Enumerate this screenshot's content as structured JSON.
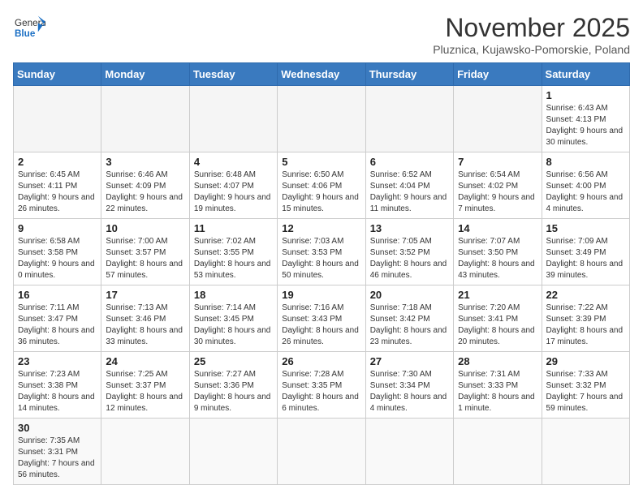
{
  "header": {
    "logo_general": "General",
    "logo_blue": "Blue",
    "month_title": "November 2025",
    "subtitle": "Pluznica, Kujawsko-Pomorskie, Poland"
  },
  "weekdays": [
    "Sunday",
    "Monday",
    "Tuesday",
    "Wednesday",
    "Thursday",
    "Friday",
    "Saturday"
  ],
  "days": {
    "d1": {
      "n": "1",
      "sr": "6:43 AM",
      "ss": "4:13 PM",
      "dl": "9 hours and 30 minutes."
    },
    "d2": {
      "n": "2",
      "sr": "6:45 AM",
      "ss": "4:11 PM",
      "dl": "9 hours and 26 minutes."
    },
    "d3": {
      "n": "3",
      "sr": "6:46 AM",
      "ss": "4:09 PM",
      "dl": "9 hours and 22 minutes."
    },
    "d4": {
      "n": "4",
      "sr": "6:48 AM",
      "ss": "4:07 PM",
      "dl": "9 hours and 19 minutes."
    },
    "d5": {
      "n": "5",
      "sr": "6:50 AM",
      "ss": "4:06 PM",
      "dl": "9 hours and 15 minutes."
    },
    "d6": {
      "n": "6",
      "sr": "6:52 AM",
      "ss": "4:04 PM",
      "dl": "9 hours and 11 minutes."
    },
    "d7": {
      "n": "7",
      "sr": "6:54 AM",
      "ss": "4:02 PM",
      "dl": "9 hours and 7 minutes."
    },
    "d8": {
      "n": "8",
      "sr": "6:56 AM",
      "ss": "4:00 PM",
      "dl": "9 hours and 4 minutes."
    },
    "d9": {
      "n": "9",
      "sr": "6:58 AM",
      "ss": "3:58 PM",
      "dl": "9 hours and 0 minutes."
    },
    "d10": {
      "n": "10",
      "sr": "7:00 AM",
      "ss": "3:57 PM",
      "dl": "8 hours and 57 minutes."
    },
    "d11": {
      "n": "11",
      "sr": "7:02 AM",
      "ss": "3:55 PM",
      "dl": "8 hours and 53 minutes."
    },
    "d12": {
      "n": "12",
      "sr": "7:03 AM",
      "ss": "3:53 PM",
      "dl": "8 hours and 50 minutes."
    },
    "d13": {
      "n": "13",
      "sr": "7:05 AM",
      "ss": "3:52 PM",
      "dl": "8 hours and 46 minutes."
    },
    "d14": {
      "n": "14",
      "sr": "7:07 AM",
      "ss": "3:50 PM",
      "dl": "8 hours and 43 minutes."
    },
    "d15": {
      "n": "15",
      "sr": "7:09 AM",
      "ss": "3:49 PM",
      "dl": "8 hours and 39 minutes."
    },
    "d16": {
      "n": "16",
      "sr": "7:11 AM",
      "ss": "3:47 PM",
      "dl": "8 hours and 36 minutes."
    },
    "d17": {
      "n": "17",
      "sr": "7:13 AM",
      "ss": "3:46 PM",
      "dl": "8 hours and 33 minutes."
    },
    "d18": {
      "n": "18",
      "sr": "7:14 AM",
      "ss": "3:45 PM",
      "dl": "8 hours and 30 minutes."
    },
    "d19": {
      "n": "19",
      "sr": "7:16 AM",
      "ss": "3:43 PM",
      "dl": "8 hours and 26 minutes."
    },
    "d20": {
      "n": "20",
      "sr": "7:18 AM",
      "ss": "3:42 PM",
      "dl": "8 hours and 23 minutes."
    },
    "d21": {
      "n": "21",
      "sr": "7:20 AM",
      "ss": "3:41 PM",
      "dl": "8 hours and 20 minutes."
    },
    "d22": {
      "n": "22",
      "sr": "7:22 AM",
      "ss": "3:39 PM",
      "dl": "8 hours and 17 minutes."
    },
    "d23": {
      "n": "23",
      "sr": "7:23 AM",
      "ss": "3:38 PM",
      "dl": "8 hours and 14 minutes."
    },
    "d24": {
      "n": "24",
      "sr": "7:25 AM",
      "ss": "3:37 PM",
      "dl": "8 hours and 12 minutes."
    },
    "d25": {
      "n": "25",
      "sr": "7:27 AM",
      "ss": "3:36 PM",
      "dl": "8 hours and 9 minutes."
    },
    "d26": {
      "n": "26",
      "sr": "7:28 AM",
      "ss": "3:35 PM",
      "dl": "8 hours and 6 minutes."
    },
    "d27": {
      "n": "27",
      "sr": "7:30 AM",
      "ss": "3:34 PM",
      "dl": "8 hours and 4 minutes."
    },
    "d28": {
      "n": "28",
      "sr": "7:31 AM",
      "ss": "3:33 PM",
      "dl": "8 hours and 1 minute."
    },
    "d29": {
      "n": "29",
      "sr": "7:33 AM",
      "ss": "3:32 PM",
      "dl": "7 hours and 59 minutes."
    },
    "d30": {
      "n": "30",
      "sr": "7:35 AM",
      "ss": "3:31 PM",
      "dl": "7 hours and 56 minutes."
    }
  }
}
